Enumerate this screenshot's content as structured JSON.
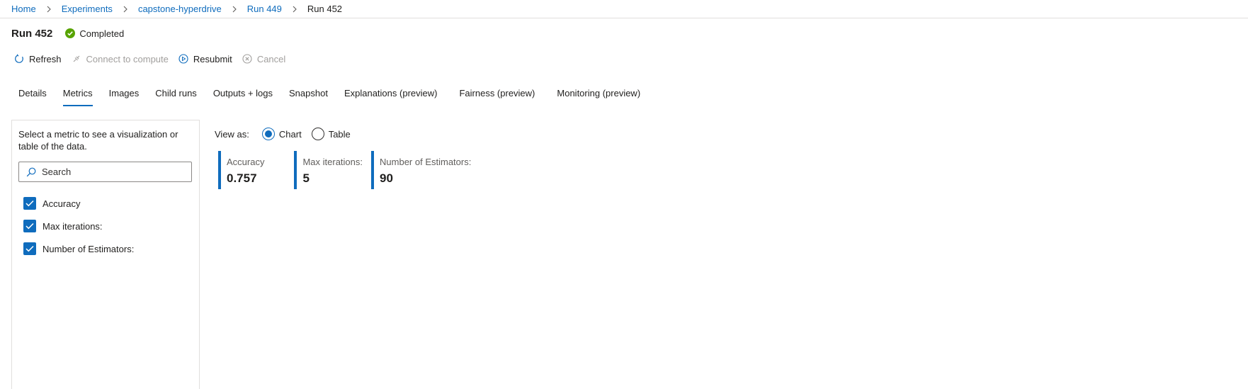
{
  "breadcrumb": {
    "items": [
      "Home",
      "Experiments",
      "capstone-hyperdrive",
      "Run 449"
    ],
    "current": "Run 452"
  },
  "header": {
    "title": "Run 452",
    "status": "Completed",
    "status_color": "#57a300"
  },
  "toolbar": {
    "refresh": "Refresh",
    "connect": "Connect to compute",
    "resubmit": "Resubmit",
    "cancel": "Cancel"
  },
  "tabs": [
    {
      "label": "Details"
    },
    {
      "label": "Metrics",
      "active": true
    },
    {
      "label": "Images"
    },
    {
      "label": "Child runs"
    },
    {
      "label": "Outputs + logs"
    },
    {
      "label": "Snapshot"
    },
    {
      "label": "Explanations (preview)"
    },
    {
      "label": "Fairness (preview)"
    },
    {
      "label": "Monitoring (preview)"
    }
  ],
  "sidebar": {
    "description": "Select a metric to see a visualization or table of the data.",
    "search_placeholder": "Search",
    "metrics": [
      {
        "label": "Accuracy",
        "checked": true
      },
      {
        "label": "Max iterations:",
        "checked": true
      },
      {
        "label": "Number of Estimators:",
        "checked": true
      }
    ]
  },
  "view": {
    "label": "View as:",
    "options": [
      "Chart",
      "Table"
    ],
    "selected": "Chart"
  },
  "metric_tiles": [
    {
      "label": "Accuracy",
      "value": "0.757"
    },
    {
      "label": "Max iterations:",
      "value": "5"
    },
    {
      "label": "Number of Estimators:",
      "value": "90"
    }
  ],
  "colors": {
    "accent": "#0f6cbd",
    "success": "#57a300"
  }
}
